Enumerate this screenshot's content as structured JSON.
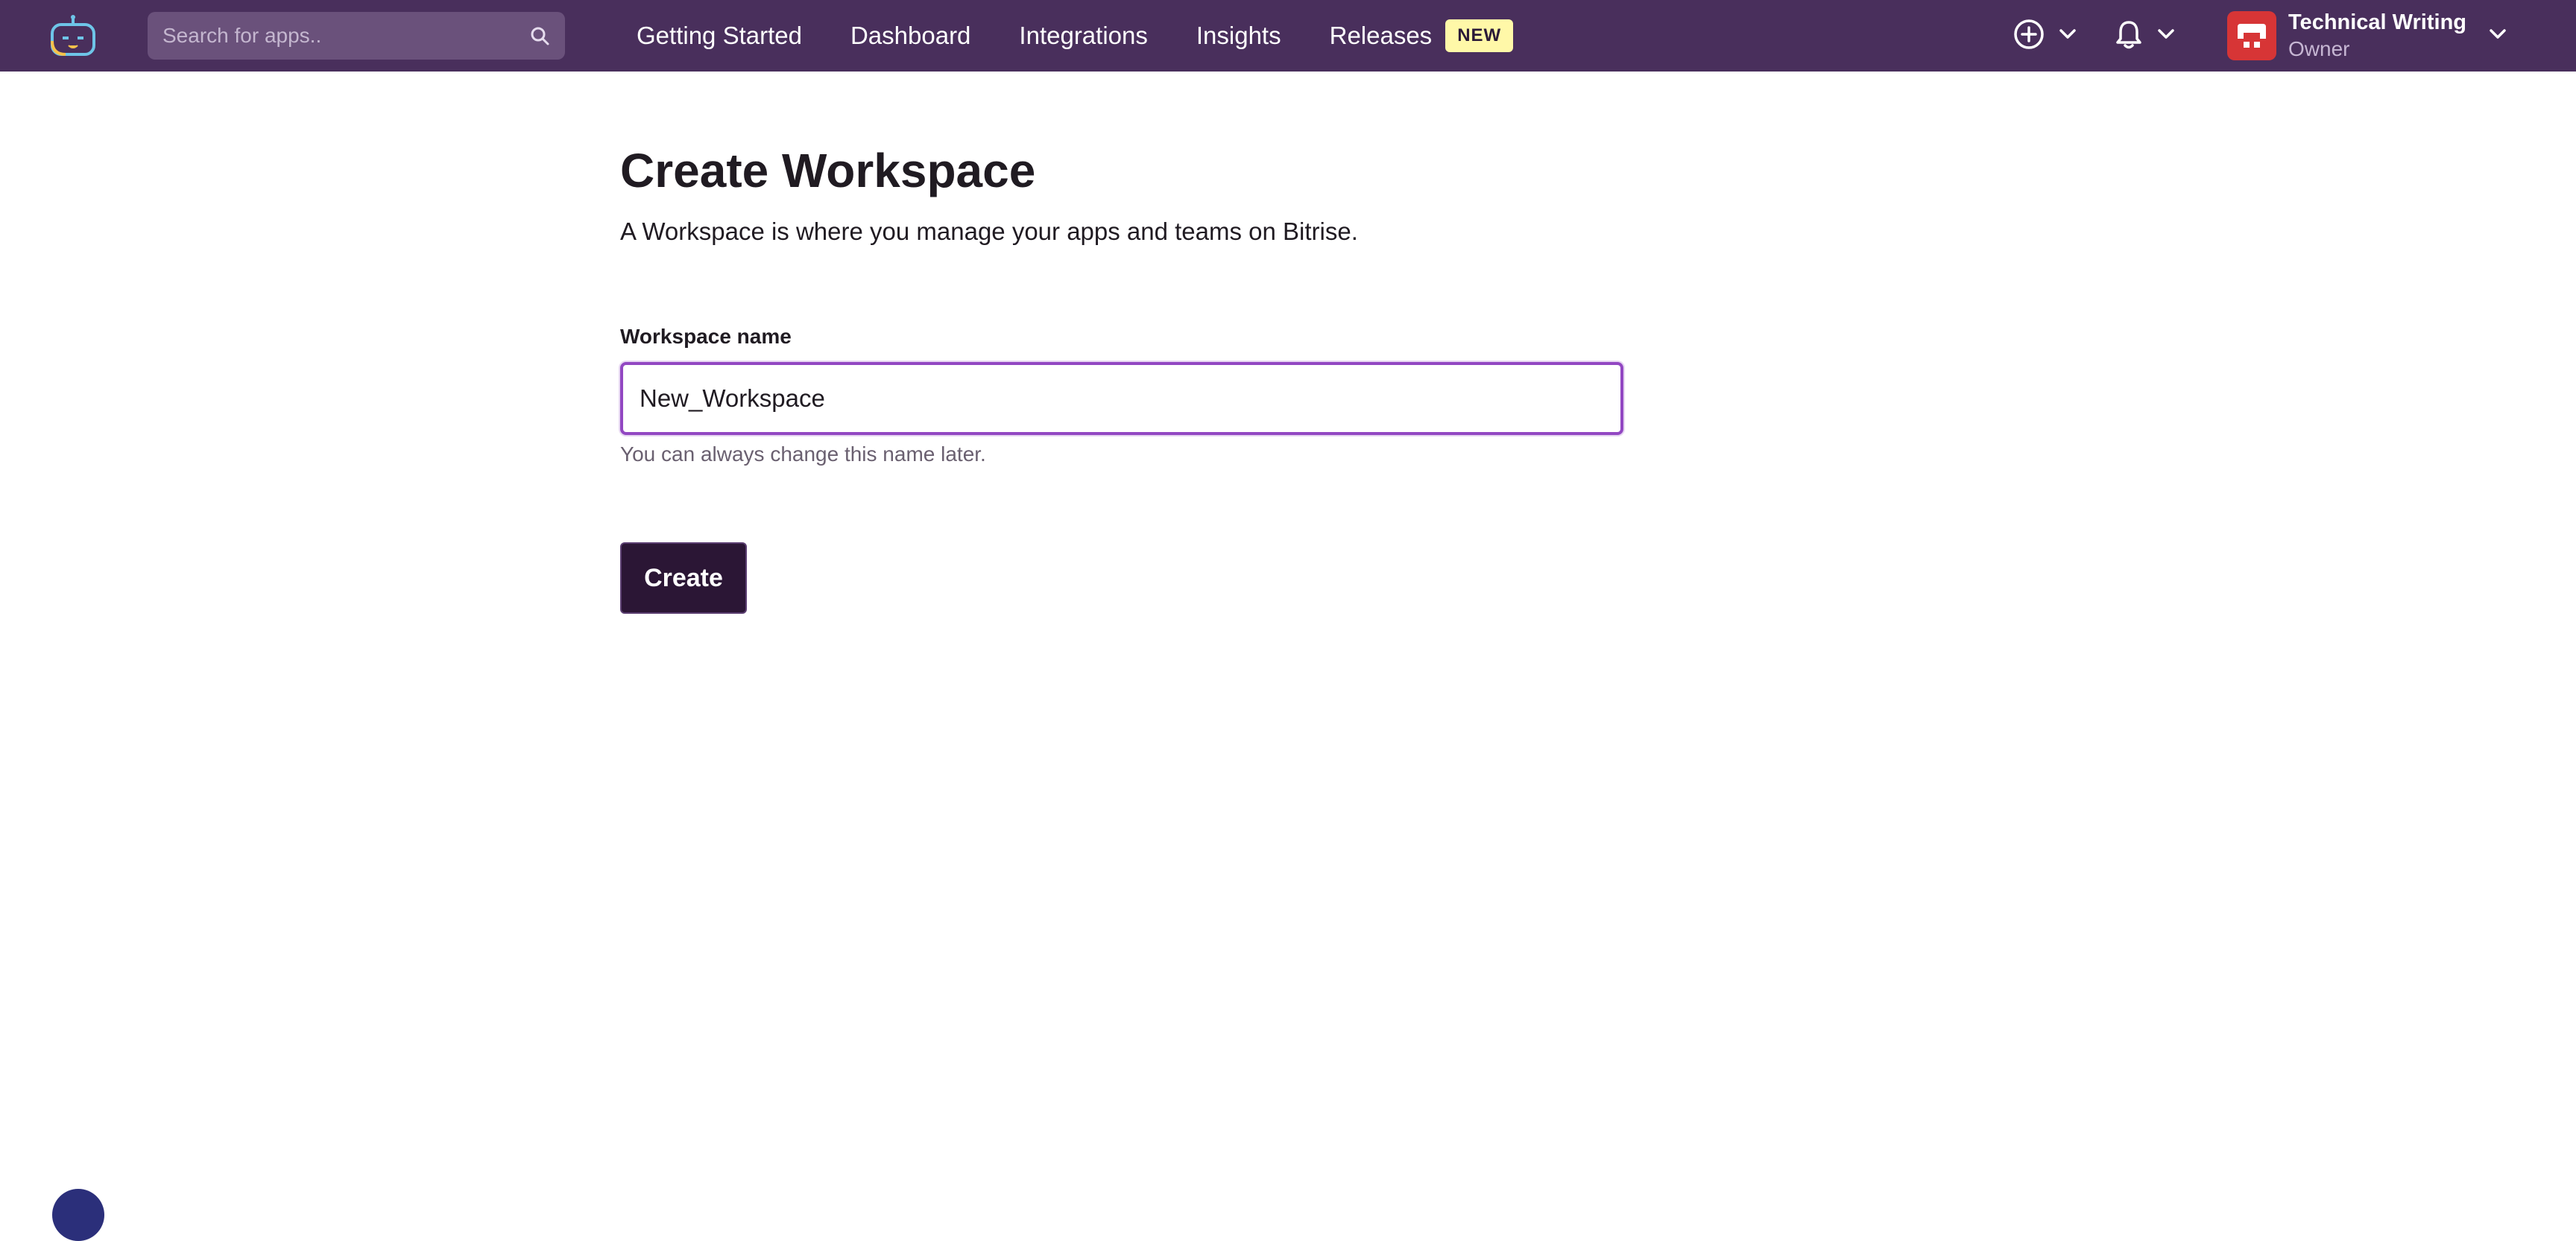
{
  "topbar": {
    "logo_icon": "bitrise-robot-logo",
    "search": {
      "placeholder": "Search for apps..",
      "value": "",
      "icon": "search-icon"
    },
    "nav": [
      {
        "label": "Getting Started"
      },
      {
        "label": "Dashboard"
      },
      {
        "label": "Integrations"
      },
      {
        "label": "Insights"
      },
      {
        "label": "Releases",
        "badge": "NEW"
      }
    ],
    "add_icon": "plus-circle-icon",
    "notifications_icon": "bell-icon",
    "account": {
      "name": "Technical Writing",
      "role": "Owner",
      "avatar_icon": "workspace-avatar-icon"
    }
  },
  "page": {
    "title": "Create Workspace",
    "subtitle": "A Workspace is where you manage your apps and teams on Bitrise.",
    "form": {
      "name_label": "Workspace name",
      "name_value": "New_Workspace",
      "name_help": "You can always change this name later.",
      "submit_label": "Create"
    }
  },
  "colors": {
    "topbar_bg": "#492f5c",
    "accent": "#9247c2",
    "button_bg": "#2b1635",
    "badge_bg": "#fff8a8",
    "avatar_bg": "#d73536"
  }
}
